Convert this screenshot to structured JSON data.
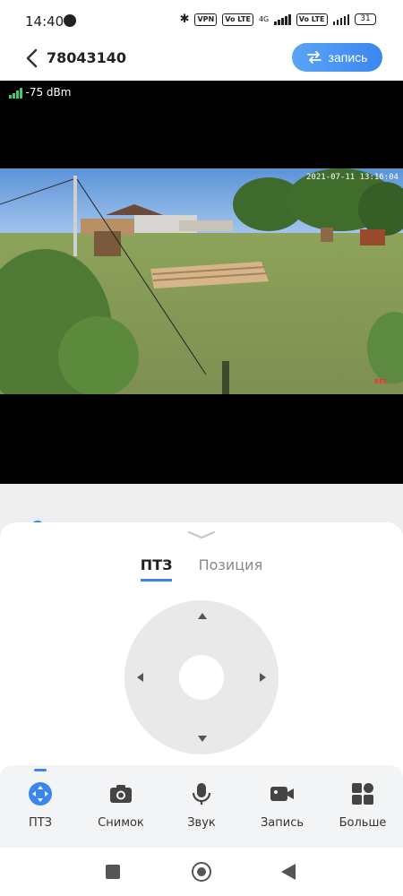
{
  "status_bar": {
    "time": "14:40",
    "chips": [
      "VPN",
      "Vo LTE",
      "Vo LTE"
    ],
    "network": "4G",
    "battery": "31"
  },
  "header": {
    "title": "78043140",
    "record_button_label": "запись",
    "accent_color": "#3a86ef"
  },
  "video": {
    "signal": "-75 dBm",
    "osd_timestamp": "2021-07-11 13:16:04",
    "rec_label": "REC"
  },
  "tabs": [
    {
      "label": "ПТЗ",
      "active": true
    },
    {
      "label": "Позиция",
      "active": false
    }
  ],
  "toolbar": {
    "items": [
      {
        "label": "ПТЗ",
        "icon": "ptz-icon",
        "active": true
      },
      {
        "label": "Снимок",
        "icon": "camera-icon",
        "active": false
      },
      {
        "label": "Звук",
        "icon": "microphone-icon",
        "active": false
      },
      {
        "label": "Запись",
        "icon": "video-camera-icon",
        "active": false
      },
      {
        "label": "Больше",
        "icon": "grid-icon",
        "active": false
      }
    ]
  }
}
